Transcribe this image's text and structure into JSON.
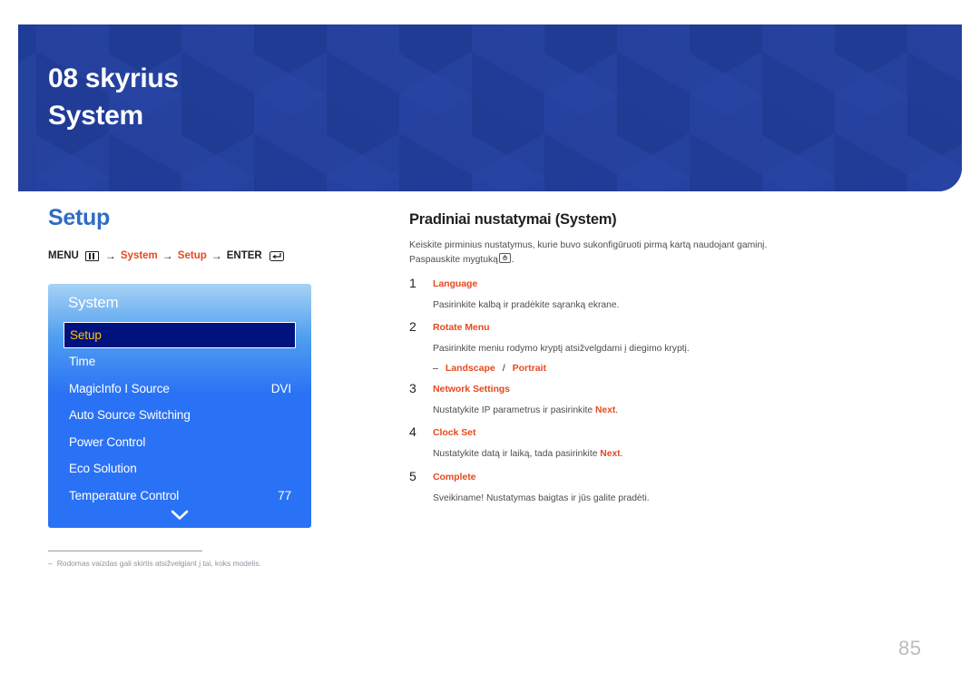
{
  "banner": {
    "chapter": "08 skyrius",
    "title": "System",
    "bg_color": "#1f3c98"
  },
  "left": {
    "section_title": "Setup",
    "section_title_color": "#2f6cc4",
    "breadcrumb": {
      "menu_label": "MENU",
      "menu_icon": "menu-grid-icon",
      "arrow": "→",
      "path1": "System",
      "path2": "Setup",
      "enter_label": "ENTER",
      "enter_icon": "enter-return-icon",
      "accent_color": "#e8491d"
    },
    "osd": {
      "title": "System",
      "selected_index": 0,
      "highlight_text_color": "#ffc000",
      "highlight_bg_color": "#00127e",
      "items": [
        {
          "label": "Setup",
          "value": "",
          "selected": true
        },
        {
          "label": "Time",
          "value": "",
          "selected": false
        },
        {
          "label": "MagicInfo I Source",
          "value": "DVI",
          "selected": false
        },
        {
          "label": "Auto Source Switching",
          "value": "",
          "selected": false
        },
        {
          "label": "Power Control",
          "value": "",
          "selected": false
        },
        {
          "label": "Eco Solution",
          "value": "",
          "selected": false
        },
        {
          "label": "Temperature Control",
          "value": "77",
          "selected": false
        }
      ],
      "scroll_icon": "chevron-down-icon"
    },
    "footnote": {
      "dash": "–",
      "text": "Rodomas vaizdas gali skirtis atsižvelgiant į tai, koks modelis."
    }
  },
  "right": {
    "title": "Pradiniai nustatymai (System)",
    "description_part1": "Keiskite pirminius nustatymus, kurie buvo sukonfigūruoti pirmą kartą naudojant gaminį. Paspauskite mygtuką",
    "description_icon": "power-button-icon",
    "description_part2": ".",
    "steps": [
      {
        "num": "1",
        "head": "Language",
        "text_before": "Pasirinkite kalbą ir pradėkite sąranką ekrane.",
        "highlight": "",
        "text_after": ""
      },
      {
        "num": "2",
        "head": "Rotate Menu",
        "text_before": "Pasirinkite meniu rodymo kryptį atsižvelgdami į diegimo kryptį.",
        "highlight": "",
        "text_after": "",
        "sub": {
          "dash": "–",
          "option1": "Landscape",
          "separator": "/",
          "option2": "Portrait"
        }
      },
      {
        "num": "3",
        "head": "Network Settings",
        "text_before": "Nustatykite IP parametrus ir pasirinkite ",
        "highlight": "Next",
        "text_after": "."
      },
      {
        "num": "4",
        "head": "Clock Set",
        "text_before": "Nustatykite datą ir laiką, tada pasirinkite ",
        "highlight": "Next",
        "text_after": "."
      },
      {
        "num": "5",
        "head": "Complete",
        "text_before": "Sveikiname! Nustatymas baigtas ir jūs galite pradėti.",
        "highlight": "",
        "text_after": ""
      }
    ]
  },
  "page_number": "85"
}
